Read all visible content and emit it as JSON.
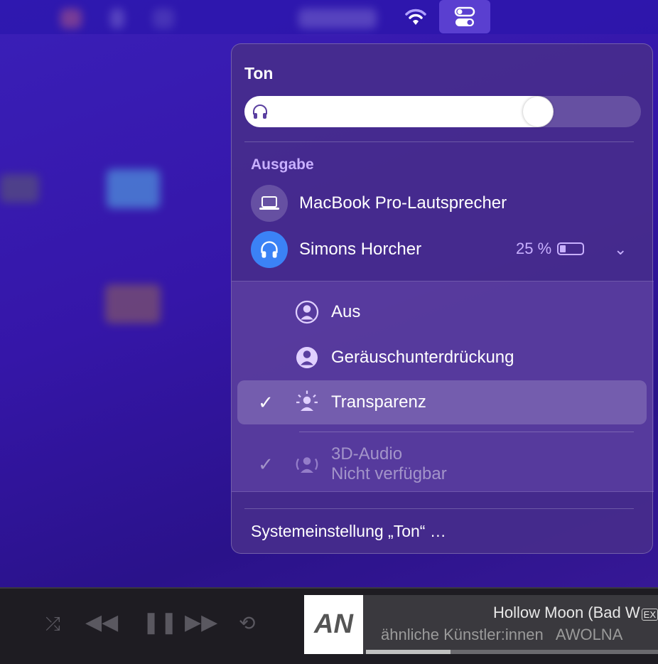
{
  "menubar": {
    "wifi_icon": "wifi-icon",
    "control_center_icon": "control-center-icon"
  },
  "sound": {
    "title": "Ton",
    "volume": 0.78,
    "output_label": "Ausgabe",
    "devices": [
      {
        "name": "MacBook Pro-Lautsprecher",
        "icon": "laptop-icon"
      },
      {
        "name": "Simons Horcher",
        "icon": "headphones-icon",
        "battery": "25 %",
        "battery_level": 0.25
      }
    ],
    "modes": [
      {
        "label": "Aus",
        "checked": false
      },
      {
        "label": "Geräuschunterdrückung",
        "checked": false
      },
      {
        "label": "Transparenz",
        "checked": true
      }
    ],
    "spatial": {
      "label": "3D-Audio",
      "status": "Nicht verfügbar"
    },
    "settings_link": "Systemeinstellung „Ton“ …"
  },
  "player": {
    "song": "Hollow Moon (Bad W",
    "explicit": "EX",
    "subtitle": "ähnliche Künstler:innen   AWOLNA",
    "artwork_text": "AN",
    "progress": 0.29
  }
}
